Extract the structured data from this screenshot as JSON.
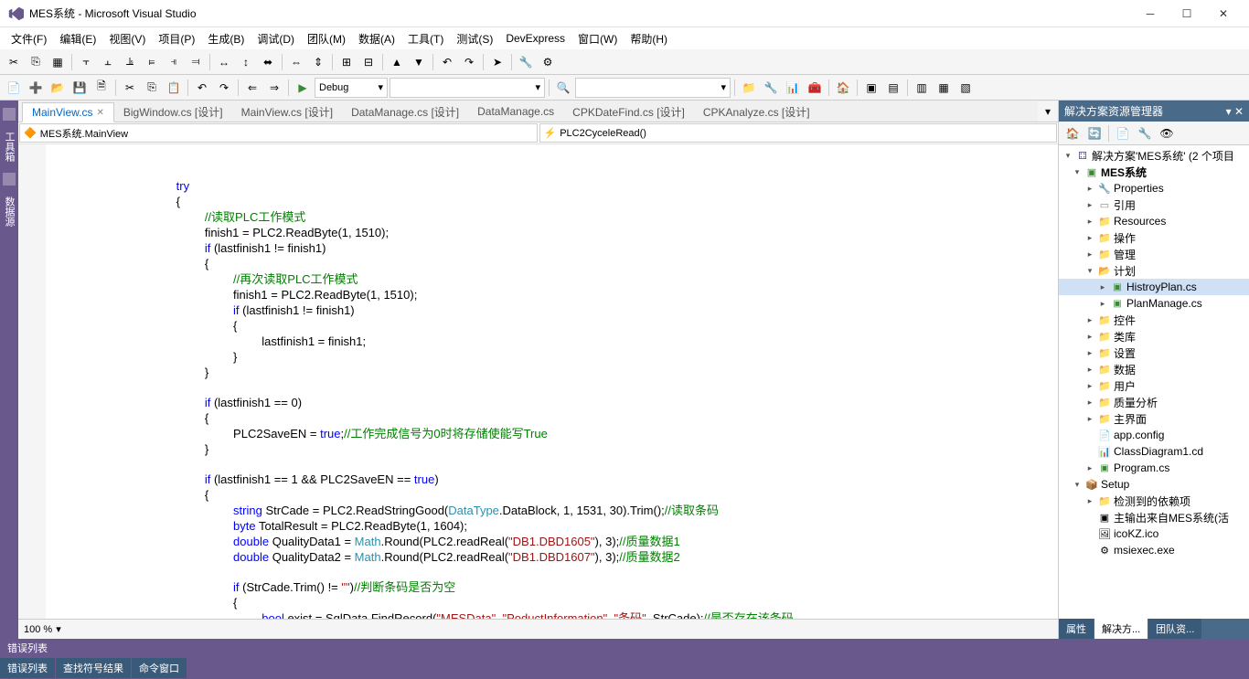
{
  "title": "MES系统 - Microsoft Visual Studio",
  "menu": [
    "文件(F)",
    "编辑(E)",
    "视图(V)",
    "项目(P)",
    "生成(B)",
    "调试(D)",
    "团队(M)",
    "数据(A)",
    "工具(T)",
    "测试(S)",
    "DevExpress",
    "窗口(W)",
    "帮助(H)"
  ],
  "toolbar": {
    "config": "Debug"
  },
  "left_tabs": [
    "工具箱",
    "数据源"
  ],
  "doc_tabs": [
    {
      "label": "MainView.cs",
      "active": true
    },
    {
      "label": "BigWindow.cs [设计]",
      "active": false
    },
    {
      "label": "MainView.cs [设计]",
      "active": false
    },
    {
      "label": "DataManage.cs [设计]",
      "active": false
    },
    {
      "label": "DataManage.cs",
      "active": false
    },
    {
      "label": "CPKDateFind.cs [设计]",
      "active": false
    },
    {
      "label": "CPKAnalyze.cs [设计]",
      "active": false
    }
  ],
  "nav": {
    "left": "MES系统.MainView",
    "right": "PLC2CyceleRead()"
  },
  "code": {
    "l1": "try",
    "l2": "{",
    "c1": "//读取PLC工作模式",
    "l3": "finish1 = PLC2.ReadByte(1, 1510);",
    "l4_a": "if",
    " l4_b": " (lastfinish1 != finish1)",
    "l5": "{",
    "c2": "//再次读取PLC工作模式",
    "l6": "finish1 = PLC2.ReadByte(1, 1510);",
    "l7_a": "if",
    "l7_b": " (lastfinish1 != finish1)",
    "l8": "{",
    "l9": "lastfinish1 = finish1;",
    "l10": "}",
    "l11": "}",
    "l12_a": "if",
    "l12_b": " (lastfinish1 == 0)",
    "l13": "{",
    "l14_a": "PLC2SaveEN = ",
    "l14_kw": "true",
    "l14_b": ";",
    "c3": "//工作完成信号为0时将存储使能写True",
    "l15": "}",
    "l16_a": "if",
    "l16_b": " (lastfinish1 == 1 && PLC2SaveEN == ",
    "l16_kw": "true",
    "l16_c": ")",
    "l17": "{",
    "l18_a": "string",
    "l18_b": " StrCade = PLC2.ReadStringGood(",
    "l18_t": "DataType",
    "l18_c": ".DataBlock, 1, 1531, 30).Trim();",
    "c4": "//读取条码",
    "l19_a": "byte",
    "l19_b": " TotalResult = PLC2.ReadByte(1, 1604);",
    "l20_a": "double",
    "l20_b": " QualityData1 = ",
    "l20_t": "Math",
    "l20_c": ".Round(PLC2.readReal(",
    "l20_s": "\"DB1.DBD1605\"",
    "l20_d": "), 3);",
    "c5": "//质量数据1",
    "l21_a": "double",
    "l21_b": " QualityData2 = ",
    "l21_t": "Math",
    "l21_c": ".Round(PLC2.readReal(",
    "l21_s": "\"DB1.DBD1607\"",
    "l21_d": "), 3);",
    "c6": "//质量数据2",
    "l22_a": "if",
    "l22_b": " (StrCade.Trim() != ",
    "l22_s": "\"\"",
    "l22_c": ")",
    "c7": "//判断条码是否为空",
    "l23": "{",
    "l24_a": "bool",
    "l24_b": " exist = SqlData.FindRecord(",
    "l24_s1": "\"MESData\"",
    "l24_c1": ", ",
    "l24_s2": "\"PoductInformation\"",
    "l24_c2": ", ",
    "l24_s3": "\"条码\"",
    "l24_c3": ", StrCade);",
    "c8": "//是否存在该条码"
  },
  "zoom": "100 %",
  "solution": {
    "panel_title": "解决方案资源管理器",
    "root": "解决方案'MES系统' (2 个项目",
    "proj1": "MES系统",
    "nodes": [
      "Properties",
      "引用",
      "Resources",
      "操作",
      "管理",
      "计划"
    ],
    "plan_children": [
      "HistroyPlan.cs",
      "PlanManage.cs"
    ],
    "nodes2": [
      "控件",
      "类库",
      "设置",
      "数据",
      "用户",
      "质量分析",
      "主界面"
    ],
    "files": [
      "app.config",
      "ClassDiagram1.cd",
      "Program.cs"
    ],
    "proj2": "Setup",
    "setup_children": [
      "检测到的依赖项",
      "主输出来自MES系统(活",
      "icoKZ.ico",
      "msiexec.exe"
    ]
  },
  "bottom": {
    "err": "错误列表",
    "tab1": "错误列表",
    "tab2": "查找符号结果",
    "tab3": "命令窗口",
    "prop": "属性",
    "sol": "解决方...",
    "team": "团队资..."
  }
}
